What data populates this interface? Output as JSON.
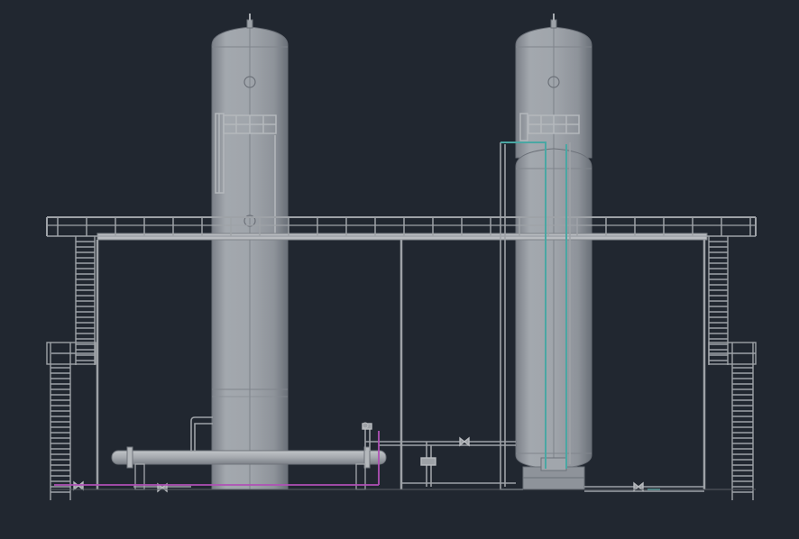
{
  "viewport": {
    "background": "#212730"
  },
  "colors": {
    "vessel_body": "#9aa0a8",
    "vessel_shade": "#6f757d",
    "vessel_edge": "#7c8189",
    "steel": "#8c9096",
    "steel_light": "#a7abb0",
    "teal_line": "#4aa7a3",
    "magenta_line": "#b050b6",
    "ground": "#5a5f66"
  },
  "scene": {
    "objects": [
      "column-1",
      "column-2",
      "drum-vessel",
      "platform-walkway",
      "stair-left-upper",
      "stair-left-lower",
      "stair-right-upper",
      "stair-right-lower",
      "horizontal-heat-exchanger",
      "piping"
    ]
  }
}
